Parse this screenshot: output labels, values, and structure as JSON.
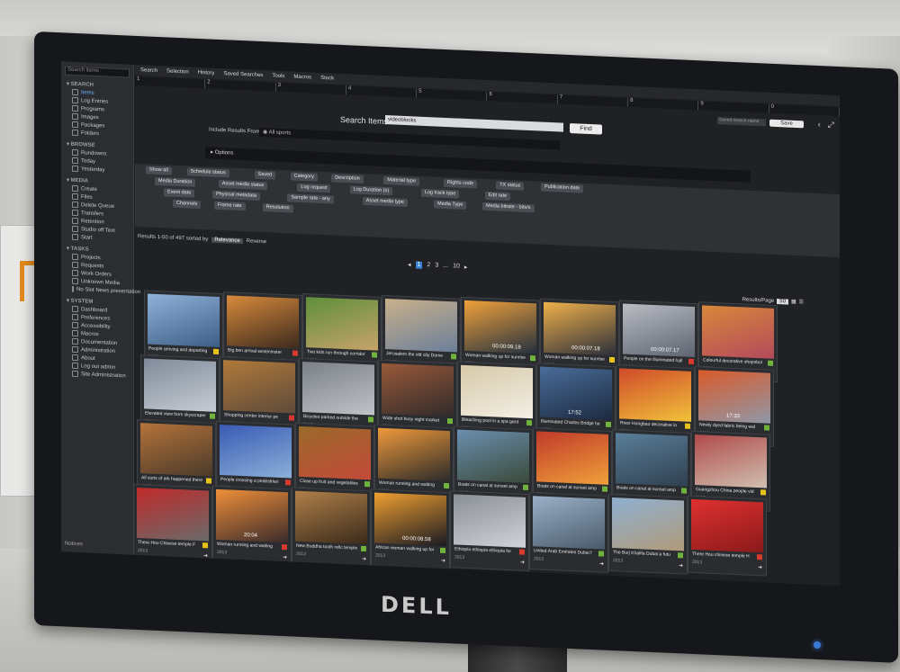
{
  "monitor": {
    "brand": "DELL"
  },
  "app": {
    "sidebar": {
      "search_placeholder": "Search items",
      "sections": [
        {
          "title": "SEARCH",
          "items": [
            "Items",
            "Log Entries",
            "Programs",
            "Images",
            "Packages",
            "Folders"
          ]
        },
        {
          "title": "BROWSE",
          "items": [
            "Rundowns",
            "Today",
            "Yesterday"
          ]
        },
        {
          "title": "MEDIA",
          "items": [
            "Create",
            "Files",
            "Delete Queue",
            "Transfers",
            "Retention",
            "Studio off Text",
            "Start"
          ]
        },
        {
          "title": "TASKS",
          "items": [
            "Projects",
            "Requests",
            "Work Orders",
            "Unknown Media",
            "No Slot News presentation"
          ]
        },
        {
          "title": "SYSTEM",
          "items": [
            "Dashboard",
            "Preferences",
            "Accessibility",
            "Macros",
            "Documentation",
            "Administration",
            "About",
            "Log out admin",
            "Site Administration"
          ]
        }
      ],
      "bottom": "Notices"
    },
    "topnav": [
      "Search",
      "Selection",
      "History",
      "Saved Searches",
      "Tools",
      "Macros",
      "Stock"
    ],
    "slots": [
      "1",
      "2",
      "3",
      "4",
      "5",
      "6",
      "7",
      "8",
      "9",
      "0"
    ],
    "saved_search_placeholder": "Saved search name",
    "save_label": "Save",
    "search_title": "Search Items",
    "search_value": "videoblocks",
    "find_label": "Find",
    "include_label": "Include Results From",
    "include_option": "All sports",
    "options_label": "Options",
    "filter_chips": [
      "Show all",
      "Schedule status",
      "Saved",
      "Category",
      "Description",
      "Material type",
      "Rights code",
      "TX status",
      "Publication date",
      "Media Duration",
      "Asset media status",
      "Log request",
      "Log Duration (s)",
      "Log track type",
      "Edit rate",
      "Event date",
      "Physical metadata",
      "Sample rate - any",
      "Asset media type",
      "Media Type",
      "Media bitrate - bits/s",
      "Channels",
      "Frame rate",
      "Resolution"
    ],
    "results_label": "Results 1-50 of 497 sorted by",
    "sort_value": "Relevance",
    "reverse_label": "Reverse",
    "pager": [
      "1",
      "2",
      "3",
      "...",
      "10"
    ],
    "results_per_page_label": "Results/Page",
    "results_per_page_value": "50",
    "thumbnails": [
      {
        "caption": "People arriving and departing",
        "year": "2013",
        "badge": "#e6c21a",
        "duration": ""
      },
      {
        "caption": "Big ben arrival westminster",
        "year": "2013",
        "badge": "#d63a2f",
        "duration": ""
      },
      {
        "caption": "Two kids run through corridor",
        "year": "2013",
        "badge": "#6fb23c",
        "duration": ""
      },
      {
        "caption": "Jerusalem the old city Dome",
        "year": "2013",
        "badge": "#6fb23c",
        "duration": ""
      },
      {
        "caption": "Woman walking up for sunrise",
        "year": "2013",
        "badge": "#6fb23c",
        "duration": "00:00:09.18"
      },
      {
        "caption": "Woman walking up for sunrise",
        "year": "2013",
        "badge": "#e6c21a",
        "duration": "00:00:07.18"
      },
      {
        "caption": "People on the illuminated hall",
        "year": "2013",
        "badge": "#d63a2f",
        "duration": "00:00:07.17"
      },
      {
        "caption": "Colourful decorative shopsbol",
        "year": "2013",
        "badge": "#6fb23c",
        "duration": ""
      },
      {
        "caption": "Elevated view from skyscraper",
        "year": "2013",
        "badge": "#6fb23c",
        "duration": ""
      },
      {
        "caption": "Shopping center interior pe",
        "year": "2013",
        "badge": "#d63a2f",
        "duration": ""
      },
      {
        "caption": "Bicycles parked outside the",
        "year": "2013",
        "badge": "#6fb23c",
        "duration": ""
      },
      {
        "caption": "Wide shot busy night market",
        "year": "2013",
        "badge": "#6fb23c",
        "duration": ""
      },
      {
        "caption": "Bleaching pool in a spa gard",
        "year": "2013",
        "badge": "#6fb23c",
        "duration": ""
      },
      {
        "caption": "Illuminated Charles Bridge he",
        "year": "2013",
        "badge": "#6fb23c",
        "duration": "17:52"
      },
      {
        "caption": "River Hongbao decorative lo",
        "year": "2013",
        "badge": "#e6c21a",
        "duration": ""
      },
      {
        "caption": "Newly dyed fabric being wal",
        "year": "2013",
        "badge": "#6fb23c",
        "duration": "17:33"
      },
      {
        "caption": "All sorts of ark happened there",
        "year": "2013",
        "badge": "#e6c21a",
        "duration": ""
      },
      {
        "caption": "People crossing a pedestrian",
        "year": "2013",
        "badge": "#d63a2f",
        "duration": ""
      },
      {
        "caption": "Close up fruit and vegetables",
        "year": "2013",
        "badge": "#6fb23c",
        "duration": ""
      },
      {
        "caption": "Woman running and waiting",
        "year": "2013",
        "badge": "#6fb23c",
        "duration": ""
      },
      {
        "caption": "Boats on canal at sunset amp",
        "year": "2013",
        "badge": "#6fb23c",
        "duration": ""
      },
      {
        "caption": "Boats on canal at sunset amp",
        "year": "2013",
        "badge": "#6fb23c",
        "duration": ""
      },
      {
        "caption": "Boats on canal at sunset amp",
        "year": "2013",
        "badge": "#6fb23c",
        "duration": ""
      },
      {
        "caption": "Guangzhou China people vid",
        "year": "2013",
        "badge": "#e6c21a",
        "duration": ""
      },
      {
        "caption": "There Hou Chinese temple F",
        "year": "2013",
        "badge": "#e6c21a",
        "duration": ""
      },
      {
        "caption": "Woman running and waiting",
        "year": "2013",
        "badge": "#d63a2f",
        "duration": "20:04"
      },
      {
        "caption": "New Buddha tooth relic temple",
        "year": "2013",
        "badge": "#6fb23c",
        "duration": ""
      },
      {
        "caption": "African woman walking up for",
        "year": "2013",
        "badge": "#6fb23c",
        "duration": "00:00:08.58"
      },
      {
        "caption": "Ethiopia ethiopia ethiopia for",
        "year": "2013",
        "badge": "#d63a2f",
        "duration": ""
      },
      {
        "caption": "United Arab Emirates Dubai f",
        "year": "2013",
        "badge": "#6fb23c",
        "duration": ""
      },
      {
        "caption": "The Burj Khalifa Dubai a futu",
        "year": "2013",
        "badge": "#6fb23c",
        "duration": ""
      },
      {
        "caption": "There Hou chinese temple H",
        "year": "2013",
        "badge": "#d63a2f",
        "duration": ""
      }
    ]
  }
}
